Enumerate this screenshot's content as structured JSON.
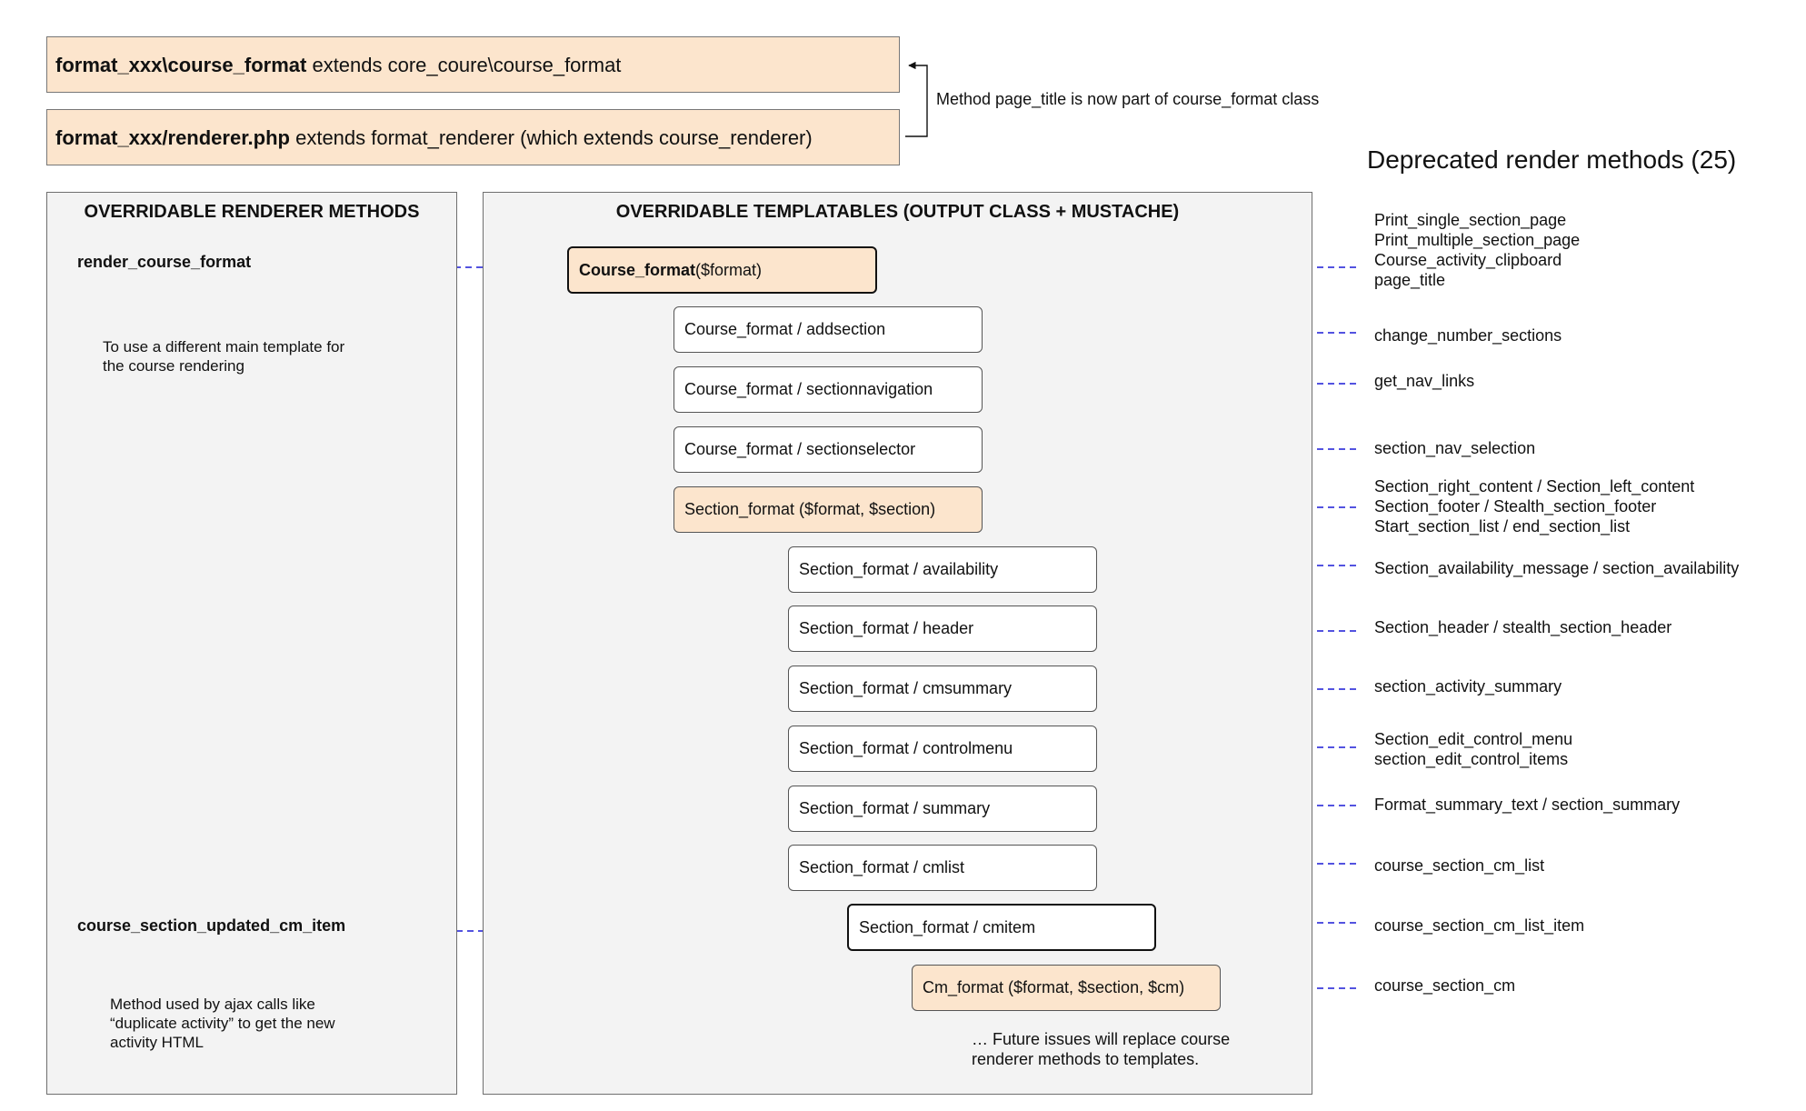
{
  "header": {
    "class_bold": "format_xxx\\course_format",
    "class_rest": " extends core_coure\\course_format",
    "renderer_bold": "format_xxx/renderer.php",
    "renderer_rest": " extends format_renderer (which extends course_renderer)",
    "note": "Method page_title is now part of course_format class"
  },
  "left_panel": {
    "title": "OVERRIDABLE RENDERER METHODS",
    "method1": "render_course_format",
    "callout1": "To use a different main template for\nthe course rendering",
    "method2": "course_section_updated_cm_item",
    "callout2": "Method used by ajax calls like\n“duplicate activity” to get the new\nactivity HTML"
  },
  "center_panel": {
    "title": "OVERRIDABLE TEMPLATABLES (OUTPUT CLASS + MUSTACHE)",
    "main_bold": "Course_format",
    "main_rest": " ($format)",
    "nodes": [
      "Course_format / addsection",
      "Course_format / sectionnavigation",
      "Course_format / sectionselector",
      "Section_format ($format, $section)",
      "Section_format / availability",
      "Section_format / header",
      "Section_format / cmsummary",
      "Section_format / controlmenu",
      "Section_format / summary",
      "Section_format / cmlist",
      "Section_format / cmitem",
      "Cm_format ($format, $section, $cm)"
    ],
    "footnote": "… Future issues will replace course\nrenderer methods to templates."
  },
  "deprecated": {
    "title": "Deprecated render methods (25)",
    "groups": [
      "Print_single_section_page\nPrint_multiple_section_page\nCourse_activity_clipboard\npage_title",
      "change_number_sections",
      "get_nav_links",
      "section_nav_selection",
      "Section_right_content / Section_left_content\nSection_footer / Stealth_section_footer\nStart_section_list / end_section_list",
      "Section_availability_message / section_availability",
      "Section_header / stealth_section_header",
      "section_activity_summary",
      "Section_edit_control_menu\nsection_edit_control_items",
      "Format_summary_text / section_summary",
      "course_section_cm_list",
      "course_section_cm_list_item",
      "course_section_cm"
    ]
  },
  "colors": {
    "orange_fill": "#fce5cd",
    "panel_fill": "#f3f3f3",
    "arrow": "#1a1ad6"
  }
}
